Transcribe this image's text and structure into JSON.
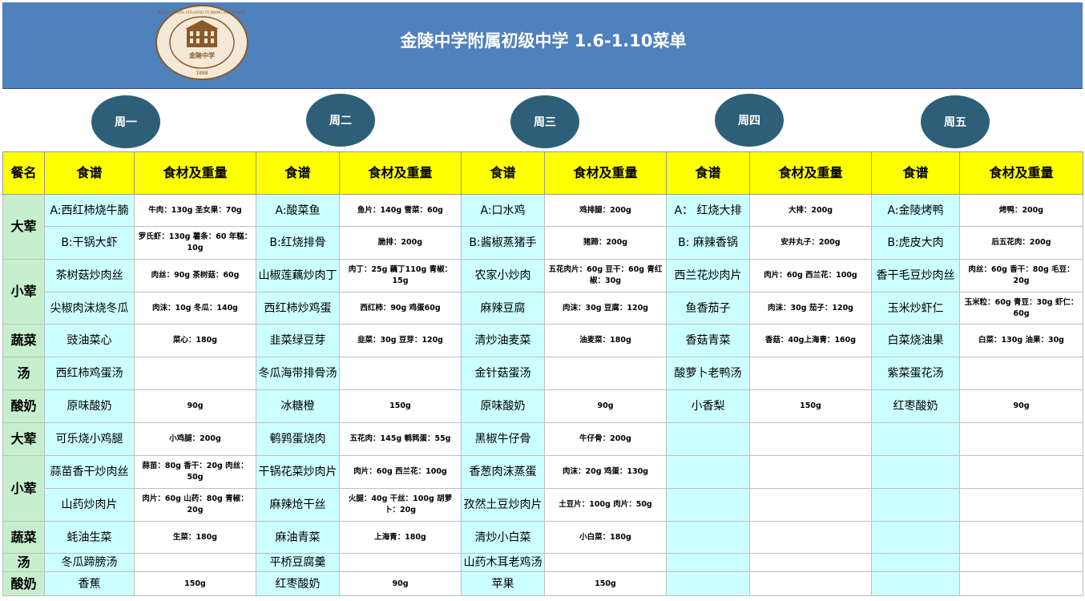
{
  "header": {
    "title": "金陵中学附属初级中学 1.6-1.10菜单",
    "logo": {
      "ring_text": "MIDDLE SCHOOL AFFILIATED TO JINLING HIGH SCHOOL",
      "center_text": "金陵中学",
      "year": "1888"
    }
  },
  "days": [
    "周一",
    "周二",
    "周三",
    "周四",
    "周五"
  ],
  "table": {
    "header_meal": "餐名",
    "header_dish": "食谱",
    "header_ing": "食材及重量",
    "rows": [
      {
        "meal": "大荤",
        "span": 2,
        "cells": [
          [
            "A:西红柿烧牛腩",
            "牛肉：130g  圣女果：70g"
          ],
          [
            "A:酸菜鱼",
            "鱼片：140g   雪菜：60g"
          ],
          [
            "A:口水鸡",
            "鸡排腿：200g"
          ],
          [
            "A：  红烧大排",
            "大排：200g"
          ],
          [
            "A:金陵烤鸭",
            "烤鸭：200g"
          ]
        ]
      },
      {
        "meal": "",
        "span": 0,
        "cells": [
          [
            "B:干锅大虾",
            "罗氏虾：130g  薯条：60  年糕：10g"
          ],
          [
            "B:红烧排骨",
            "脆排：200g"
          ],
          [
            "B:酱椒蒸猪手",
            "猪蹄：200g"
          ],
          [
            "B: 麻辣香锅",
            "安井丸子：200g"
          ],
          [
            "B:虎皮大肉",
            "后五花肉：200g"
          ]
        ]
      },
      {
        "meal": "小荤",
        "span": 2,
        "cells": [
          [
            "茶树菇炒肉丝",
            "肉丝：90g 茶树菇：60g"
          ],
          [
            "山椒莲藕炒肉丁",
            "肉丁：25g  藕丁110g    青椒：15g"
          ],
          [
            "农家小炒肉",
            "五花肉片：60g 豆干：60g  青红椒：30g"
          ],
          [
            "西兰花炒肉片",
            "肉片：60g   西兰花：100g"
          ],
          [
            "香干毛豆炒肉丝",
            "肉丝：60g 香干：80g    毛豆：20g"
          ]
        ]
      },
      {
        "meal": "",
        "span": 0,
        "cells": [
          [
            "尖椒肉沫烧冬瓜",
            "肉沫：10g   冬瓜：140g"
          ],
          [
            "西红柿炒鸡蛋",
            "西红柿：90g  鸡蛋60g"
          ],
          [
            "麻辣豆腐",
            "肉沫：30g    豆腐：120g"
          ],
          [
            "鱼香茄子",
            "肉沫：30g 茄子：120g"
          ],
          [
            "玉米炒虾仁",
            "玉米粒：60g 青豆：30g 虾仁：60g"
          ]
        ]
      },
      {
        "meal": "蔬菜",
        "span": 1,
        "cells": [
          [
            "豉油菜心",
            "菜心：180g"
          ],
          [
            "韭菜绿豆芽",
            "韭菜：30g 豆芽：120g"
          ],
          [
            "清炒油麦菜",
            "油麦菜：180g"
          ],
          [
            "香菇青菜",
            "香菇：40g上海青：160g"
          ],
          [
            "白菜烧油果",
            "白菜：130g  油果：30g"
          ]
        ]
      },
      {
        "meal": "汤",
        "span": 1,
        "cells": [
          [
            "西红柿鸡蛋汤",
            ""
          ],
          [
            "冬瓜海带排骨汤",
            ""
          ],
          [
            "金针菇蛋汤",
            ""
          ],
          [
            "酸萝卜老鸭汤",
            ""
          ],
          [
            "紫菜蛋花汤",
            ""
          ]
        ]
      },
      {
        "meal": "酸奶",
        "span": 1,
        "cells": [
          [
            "原味酸奶",
            "90g"
          ],
          [
            "冰糖橙",
            "150g"
          ],
          [
            "原味酸奶",
            "90g"
          ],
          [
            "小香梨",
            "150g"
          ],
          [
            "红枣酸奶",
            "90g"
          ]
        ]
      },
      {
        "meal": "大荤",
        "span": 1,
        "cells": [
          [
            "可乐烧小鸡腿",
            "小鸡腿：200g"
          ],
          [
            "鹌鹑蛋烧肉",
            "五花肉：145g   鹌鹑蛋：55g"
          ],
          [
            "黑椒牛仔骨",
            "牛仔骨：200g"
          ],
          [
            "",
            ""
          ],
          [
            "",
            ""
          ]
        ]
      },
      {
        "meal": "小荤",
        "span": 2,
        "cells": [
          [
            "蒜苗香干炒肉丝",
            "蒜苗：80g 香干：20g          肉丝：50g"
          ],
          [
            "干锅花菜炒肉片",
            "肉片：60g   西兰花：100g"
          ],
          [
            "香葱肉沫蒸蛋",
            "肉沫：20g 鸡蛋：130g"
          ],
          [
            "",
            ""
          ],
          [
            "",
            ""
          ]
        ]
      },
      {
        "meal": "",
        "span": 0,
        "cells": [
          [
            "山药炒肉片",
            "肉片：60g   山药：80g      青椒：20g"
          ],
          [
            "麻辣炝干丝",
            "火腿：40g 干丝：100g    胡萝卜：20g"
          ],
          [
            "孜然土豆炒肉片",
            "土豆片：100g  肉片：50g"
          ],
          [
            "",
            ""
          ],
          [
            "",
            ""
          ]
        ]
      },
      {
        "meal": "蔬菜",
        "span": 1,
        "cells": [
          [
            "蚝油生菜",
            "生菜：180g"
          ],
          [
            "麻油青菜",
            "上海青：180g"
          ],
          [
            "清炒小白菜",
            "小白菜：180g"
          ],
          [
            "",
            ""
          ],
          [
            "",
            ""
          ]
        ]
      },
      {
        "meal": "汤",
        "span": 1,
        "cells": [
          [
            "冬瓜蹄膀汤",
            ""
          ],
          [
            "平桥豆腐羹",
            ""
          ],
          [
            "山药木耳老鸡汤",
            ""
          ],
          [
            "",
            ""
          ],
          [
            "",
            ""
          ]
        ]
      },
      {
        "meal": "酸奶",
        "span": 1,
        "cells": [
          [
            "香蕉",
            "150g"
          ],
          [
            "红枣酸奶",
            "90g"
          ],
          [
            "苹果",
            "150g"
          ],
          [
            "",
            ""
          ],
          [
            "",
            ""
          ]
        ]
      }
    ]
  },
  "colors": {
    "header_bg": "#4f81bd",
    "day_circle": "#2e5f78",
    "col_header": "#ffff00",
    "meal_col": "#c6efce",
    "dish_col": "#ccffff"
  }
}
